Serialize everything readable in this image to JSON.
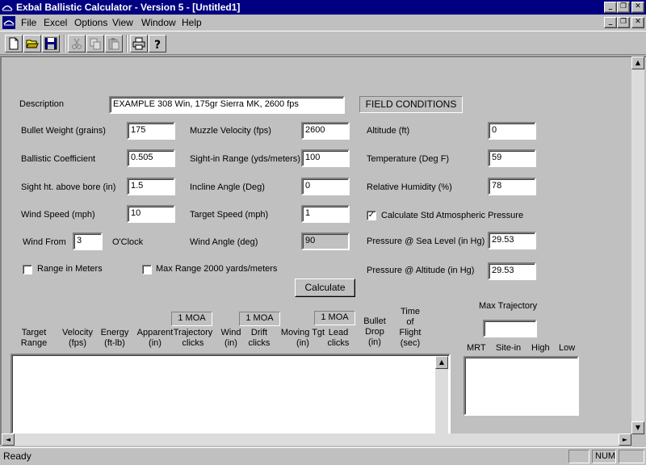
{
  "window": {
    "title": "Exbal Ballistic Calculator - Version 5 - [Untitled1]",
    "caption_buttons": [
      "_",
      "❐",
      "✕"
    ]
  },
  "menu": {
    "items": [
      {
        "label": "File"
      },
      {
        "label": "Excel"
      },
      {
        "label": "Options"
      },
      {
        "label": "View"
      },
      {
        "label": "Window"
      },
      {
        "label": "Help"
      }
    ]
  },
  "toolbar": {
    "buttons": [
      "new-file-icon",
      "open-folder-icon",
      "save-disk-icon",
      "cut-icon",
      "copy-icon",
      "paste-icon",
      "print-icon",
      "help-icon"
    ]
  },
  "form": {
    "description_label": "Description",
    "description_value": "EXAMPLE 308 Win, 175gr Sierra MK, 2600 fps",
    "field_conditions_label": "FIELD  CONDITIONS",
    "bullet_weight": {
      "label": "Bullet Weight (grains)",
      "value": "175"
    },
    "ballistic_coefficient": {
      "label": "Ballistic Coefficient",
      "value": "0.505"
    },
    "sight_height": {
      "label": "Sight ht. above bore (in)",
      "value": "1.5"
    },
    "wind_speed": {
      "label": "Wind Speed (mph)",
      "value": "10"
    },
    "wind_from": {
      "label": "Wind From",
      "value": "3",
      "suffix": "O'Clock"
    },
    "muzzle_velocity": {
      "label": "Muzzle Velocity (fps)",
      "value": "2600"
    },
    "sight_in_range": {
      "label": "Sight-in Range (yds/meters)",
      "value": "100"
    },
    "incline_angle": {
      "label": "Incline Angle (Deg)",
      "value": "0"
    },
    "target_speed": {
      "label": "Target Speed (mph)",
      "value": "1"
    },
    "wind_angle": {
      "label": "Wind Angle (deg)",
      "value": "90"
    },
    "altitude": {
      "label": "Altitude (ft)",
      "value": "0"
    },
    "temperature": {
      "label": "Temperature (Deg F)",
      "value": "59"
    },
    "humidity": {
      "label": "Relative Humidity (%)",
      "value": "78"
    },
    "calc_std_pressure": {
      "label": "Calculate Std Atmospheric Pressure",
      "checked": true,
      "mark": "✓"
    },
    "pressure_sea": {
      "label": "Pressure @ Sea Level (in Hg)",
      "value": "29.53"
    },
    "pressure_alt": {
      "label": "Pressure @ Altitude (in Hg)",
      "value": "29.53"
    },
    "range_meters": {
      "label": "Range in Meters",
      "checked": false
    },
    "max_range": {
      "label": "Max Range 2000 yards/meters",
      "checked": false
    },
    "calculate_label": "Calculate"
  },
  "results": {
    "moa_buttons": [
      "1 MOA",
      "1 MOA",
      "1 MOA"
    ],
    "headers": [
      {
        "lines": [
          "Target",
          "Range"
        ]
      },
      {
        "lines": [
          "Velocity",
          "(fps)"
        ]
      },
      {
        "lines": [
          "Energy",
          "(ft-lb)"
        ]
      },
      {
        "lines": [
          "Apparent",
          "(in)"
        ]
      },
      {
        "lines": [
          "Trajectory",
          "clicks"
        ]
      },
      {
        "lines": [
          "Wind",
          "(in)"
        ]
      },
      {
        "lines": [
          "Drift",
          "clicks"
        ]
      },
      {
        "lines": [
          "Moving Tgt",
          "(in)"
        ]
      },
      {
        "lines": [
          "Lead",
          "clicks"
        ]
      },
      {
        "lines": [
          "Bullet",
          "Drop",
          "(in)"
        ]
      },
      {
        "lines": [
          "Time",
          "of",
          "Flight",
          "(sec)"
        ]
      }
    ]
  },
  "max_trajectory": {
    "label": "Max Trajectory",
    "value": "",
    "columns": [
      "MRT",
      "Site-in",
      "High",
      "Low"
    ]
  },
  "scroll": {
    "up": "▲",
    "down": "▼",
    "left": "◄",
    "right": "►"
  },
  "status": {
    "text": "Ready",
    "num": "NUM"
  }
}
